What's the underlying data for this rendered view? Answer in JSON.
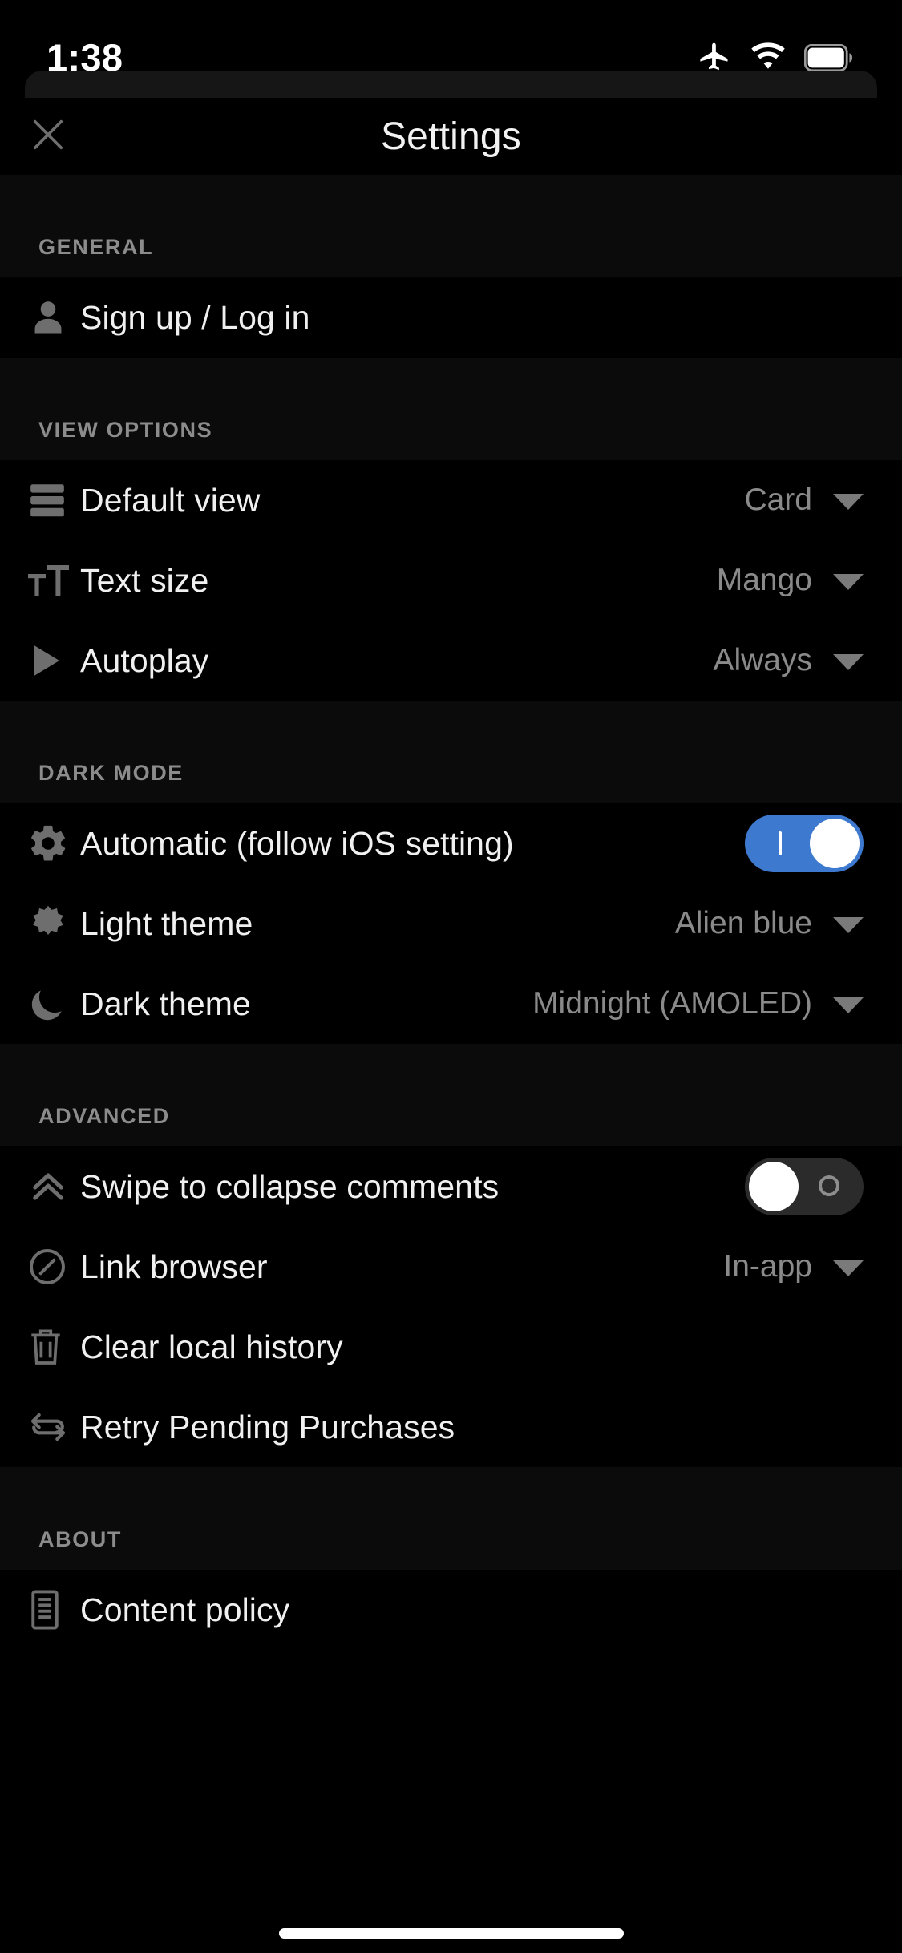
{
  "statusbar": {
    "time": "1:38",
    "icons": [
      "airplane-mode-icon",
      "wifi-icon",
      "battery-icon"
    ]
  },
  "navbar": {
    "close_icon": "close-icon",
    "title": "Settings"
  },
  "theme": {
    "background": "#000000",
    "section_header_background": "#0b0b0b",
    "primary_text": "#f0f0f0",
    "secondary_text": "#8a8a8a",
    "icon_color": "#6e6e6e",
    "toggle_on": "#3d79cf",
    "toggle_off": "#2b2b2b",
    "knob": "#ffffff"
  },
  "sections": [
    {
      "title": "GENERAL",
      "rows": [
        {
          "icon": "person-icon",
          "label": "Sign up / Log in",
          "type": "link"
        }
      ]
    },
    {
      "title": "VIEW OPTIONS",
      "rows": [
        {
          "icon": "list-card-icon",
          "label": "Default view",
          "type": "select",
          "value": "Card"
        },
        {
          "icon": "text-size-icon",
          "label": "Text size",
          "type": "select",
          "value": "Mango"
        },
        {
          "icon": "play-icon",
          "label": "Autoplay",
          "type": "select",
          "value": "Always"
        }
      ]
    },
    {
      "title": "DARK MODE",
      "rows": [
        {
          "icon": "gear-icon",
          "label": "Automatic (follow iOS setting)",
          "type": "toggle",
          "value": "on"
        },
        {
          "icon": "sun-icon",
          "label": "Light theme",
          "type": "select",
          "value": "Alien blue"
        },
        {
          "icon": "moon-icon",
          "label": "Dark theme",
          "type": "select",
          "value": "Midnight (AMOLED)"
        }
      ]
    },
    {
      "title": "ADVANCED",
      "rows": [
        {
          "icon": "chevron-up-double-icon",
          "label": "Swipe to collapse comments",
          "type": "toggle",
          "value": "off"
        },
        {
          "icon": "compass-icon",
          "label": "Link browser",
          "type": "select",
          "value": "In-app"
        },
        {
          "icon": "trash-icon",
          "label": "Clear local history",
          "type": "link"
        },
        {
          "icon": "refresh-icon",
          "label": "Retry Pending Purchases",
          "type": "link"
        }
      ]
    },
    {
      "title": "ABOUT",
      "rows": [
        {
          "icon": "document-icon",
          "label": "Content policy",
          "type": "link"
        }
      ]
    }
  ]
}
